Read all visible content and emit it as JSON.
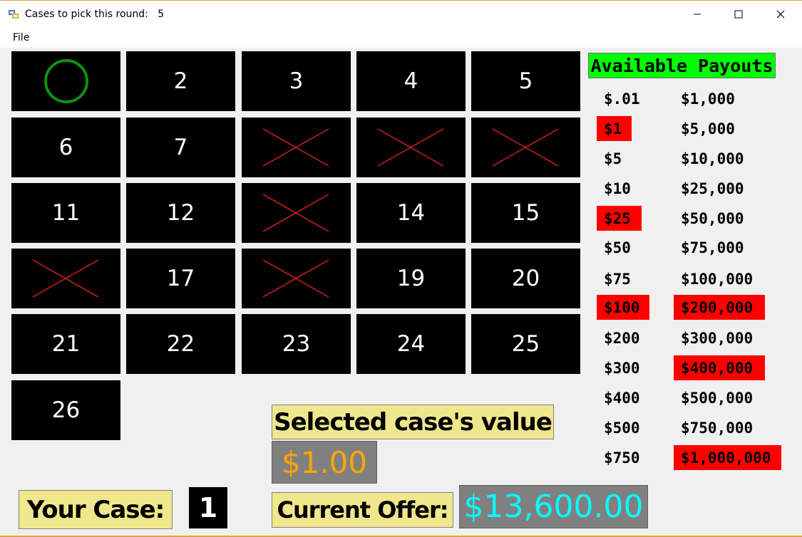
{
  "window": {
    "title": "Cases to pick this round:   5",
    "icon": "app-window-icon",
    "controls": [
      "minimize-icon",
      "maximize-icon",
      "close-icon"
    ]
  },
  "menu": {
    "file_label": "File"
  },
  "cases": [
    {
      "label": "",
      "state": "selected-circle"
    },
    {
      "label": "2",
      "state": "open"
    },
    {
      "label": "3",
      "state": "open"
    },
    {
      "label": "4",
      "state": "open"
    },
    {
      "label": "5",
      "state": "open"
    },
    {
      "label": "6",
      "state": "open"
    },
    {
      "label": "7",
      "state": "open"
    },
    {
      "label": "",
      "state": "eliminated"
    },
    {
      "label": "",
      "state": "eliminated"
    },
    {
      "label": "",
      "state": "eliminated"
    },
    {
      "label": "11",
      "state": "open"
    },
    {
      "label": "12",
      "state": "open"
    },
    {
      "label": "",
      "state": "eliminated"
    },
    {
      "label": "14",
      "state": "open"
    },
    {
      "label": "15",
      "state": "open"
    },
    {
      "label": "",
      "state": "eliminated"
    },
    {
      "label": "17",
      "state": "open"
    },
    {
      "label": "",
      "state": "eliminated"
    },
    {
      "label": "19",
      "state": "open"
    },
    {
      "label": "20",
      "state": "open"
    },
    {
      "label": "21",
      "state": "open"
    },
    {
      "label": "22",
      "state": "open"
    },
    {
      "label": "23",
      "state": "open"
    },
    {
      "label": "24",
      "state": "open"
    },
    {
      "label": "25",
      "state": "open"
    },
    {
      "label": "26",
      "state": "open"
    }
  ],
  "payouts": {
    "title": "Available Payouts",
    "left": [
      {
        "value": "$.01",
        "eliminated": false
      },
      {
        "value": "$1",
        "eliminated": true
      },
      {
        "value": "$5",
        "eliminated": false
      },
      {
        "value": "$10",
        "eliminated": false
      },
      {
        "value": "$25",
        "eliminated": true
      },
      {
        "value": "$50",
        "eliminated": false
      },
      {
        "value": "$75",
        "eliminated": false
      },
      {
        "value": "$100",
        "eliminated": true
      },
      {
        "value": "$200",
        "eliminated": false
      },
      {
        "value": "$300",
        "eliminated": false
      },
      {
        "value": "$400",
        "eliminated": false
      },
      {
        "value": "$500",
        "eliminated": false
      },
      {
        "value": "$750",
        "eliminated": false
      }
    ],
    "right": [
      {
        "value": "$1,000",
        "eliminated": false
      },
      {
        "value": "$5,000",
        "eliminated": false
      },
      {
        "value": "$10,000",
        "eliminated": false
      },
      {
        "value": "$25,000",
        "eliminated": false
      },
      {
        "value": "$50,000",
        "eliminated": false
      },
      {
        "value": "$75,000",
        "eliminated": false
      },
      {
        "value": "$100,000",
        "eliminated": false
      },
      {
        "value": "$200,000",
        "eliminated": true
      },
      {
        "value": "$300,000",
        "eliminated": false
      },
      {
        "value": "$400,000",
        "eliminated": true
      },
      {
        "value": "$500,000",
        "eliminated": false
      },
      {
        "value": "$750,000",
        "eliminated": false
      },
      {
        "value": "$1,000,000",
        "eliminated": true
      }
    ]
  },
  "selected_case": {
    "label": "Selected case's value",
    "value": "$1.00"
  },
  "your_case": {
    "label": "Your Case:",
    "number": "1"
  },
  "current_offer": {
    "label": "Current Offer:",
    "value": "$13,600.00"
  },
  "colors": {
    "case_bg": "#000000",
    "eliminated_x": "#d02020",
    "selected_circle": "#109010",
    "payouts_header": "#00ff00",
    "payout_eliminated": "#ff0000",
    "label_bg": "#f0e68c",
    "selected_value_text": "#ffa500",
    "offer_value_text": "#00ffff",
    "value_box_bg": "#808080"
  }
}
